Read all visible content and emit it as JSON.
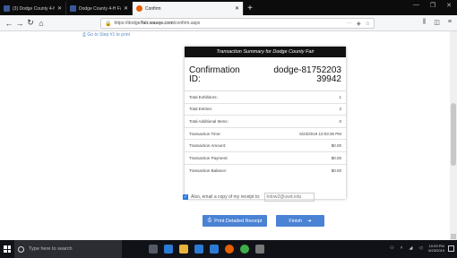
{
  "browser": {
    "tabs": [
      {
        "title": "(3) Dodge County 4-H (Webs",
        "color": "#3b5998",
        "active": false
      },
      {
        "title": "Dodge County 4-H Fair - Scro",
        "color": "#3b5998",
        "active": false
      },
      {
        "title": "Confirm",
        "color": "#e66000",
        "active": true
      }
    ],
    "new_tab": "+",
    "url": "https://dodge/",
    "url_bold": "fair.wasqe.com",
    "url_tail": "/confirm.aspx",
    "url_menu": "···",
    "window_controls": [
      "—",
      "❐",
      "✕"
    ]
  },
  "page": {
    "back_link": "Go to Step #1 to print",
    "card": {
      "header": "Transaction Summary for Dodge County Fair",
      "confirmation_label": "Confirmation ID:",
      "confirmation_value": "dodge-8175220339942",
      "rows": [
        {
          "label": "Total Exhibitors:",
          "value": "1"
        },
        {
          "label": "Total Entries:",
          "value": "2"
        },
        {
          "label": "Total Additional Items:",
          "value": "0"
        },
        {
          "label": "Transaction Time:",
          "value": "6/23/2019 10:03:35 PM"
        },
        {
          "label": "Transaction Amount:",
          "value": "$0.00"
        },
        {
          "label": "Transaction Payment:",
          "value": "$0.00"
        },
        {
          "label": "Transaction Balance:",
          "value": "$0.00"
        }
      ]
    },
    "email_checkbox_label": "Also, email a copy of my receipt to:",
    "email_value": "hdow2@uwd.edu",
    "print_button": "Print Detailed Receipt",
    "finish_button": "Finish"
  },
  "taskbar": {
    "search_placeholder": "Type here to search",
    "clock_time": "10:03 PM",
    "clock_date": "6/23/2019",
    "icons": [
      {
        "name": "task-view",
        "color": "#555a66"
      },
      {
        "name": "edge",
        "color": "#2b7bd4"
      },
      {
        "name": "file-explorer",
        "color": "#e8b33a"
      },
      {
        "name": "store",
        "color": "#2b7bd4"
      },
      {
        "name": "mail",
        "color": "#2b7bd4"
      },
      {
        "name": "firefox",
        "color": "#e66000"
      },
      {
        "name": "chrome",
        "color": "#3fae49"
      },
      {
        "name": "app",
        "color": "#777777"
      }
    ]
  },
  "colors": {
    "accent": "#4a82d4",
    "header_bg": "#111111"
  }
}
